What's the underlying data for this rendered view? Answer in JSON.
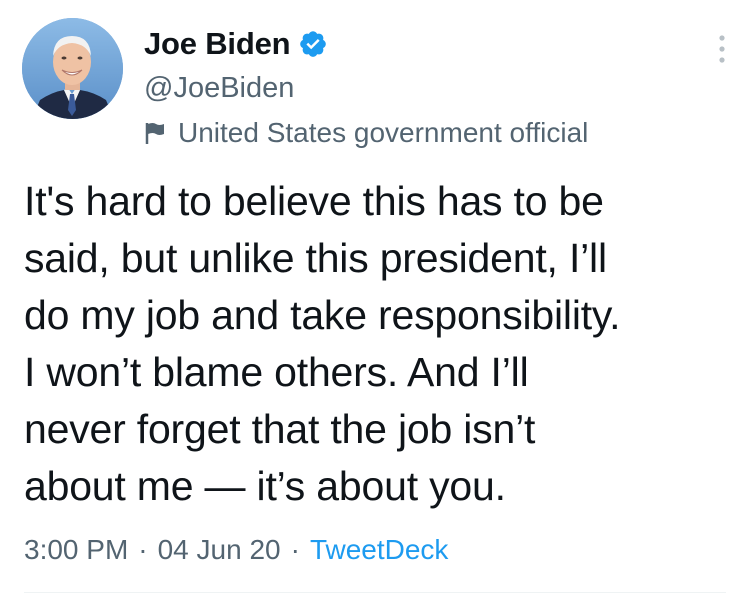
{
  "author": {
    "display_name": "Joe Biden",
    "handle": "@JoeBiden",
    "verified": true,
    "account_label": "United States government official"
  },
  "tweet": {
    "text": "It's hard to believe this has to be\nsaid, but unlike this president, I’ll\ndo my job and take responsibility.\nI won’t blame others. And I’ll\nnever forget that the job isn’t\nabout me — it’s about you.",
    "time": "3:00 PM",
    "date": "04 Jun 20",
    "source": "TweetDeck",
    "separator": "·"
  },
  "colors": {
    "verified_badge": "#1d9bf0",
    "secondary_text": "#536471",
    "link": "#1d9bf0"
  },
  "icons": {
    "verified": "verified-badge-icon",
    "label": "flag-icon",
    "more": "more-options-icon"
  }
}
